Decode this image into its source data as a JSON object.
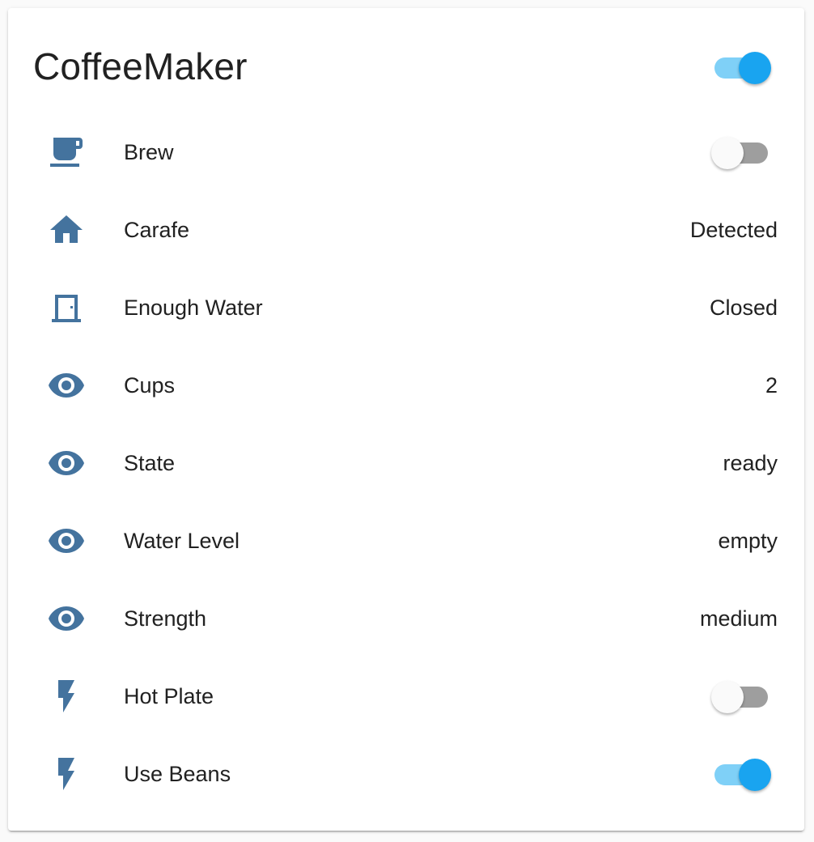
{
  "card": {
    "title": "CoffeeMaker",
    "master_toggle_on": true
  },
  "rows": [
    {
      "label": "Brew",
      "icon": "coffee-cup-icon",
      "kind": "toggle",
      "on": false
    },
    {
      "label": "Carafe",
      "icon": "home-icon",
      "kind": "value",
      "value": "Detected"
    },
    {
      "label": "Enough Water",
      "icon": "door-icon",
      "kind": "value",
      "value": "Closed"
    },
    {
      "label": "Cups",
      "icon": "eye-icon",
      "kind": "value",
      "value": "2"
    },
    {
      "label": "State",
      "icon": "eye-icon",
      "kind": "value",
      "value": "ready"
    },
    {
      "label": "Water Level",
      "icon": "eye-icon",
      "kind": "value",
      "value": "empty"
    },
    {
      "label": "Strength",
      "icon": "eye-icon",
      "kind": "value",
      "value": "medium"
    },
    {
      "label": "Hot Plate",
      "icon": "flash-icon",
      "kind": "toggle",
      "on": false
    },
    {
      "label": "Use Beans",
      "icon": "flash-icon",
      "kind": "toggle",
      "on": true
    }
  ],
  "colors": {
    "icon": "#44739e",
    "toggle_on_thumb": "#19a4f0",
    "toggle_on_track": "#7fd0f7",
    "toggle_off_thumb": "#fafafa",
    "toggle_off_track": "#9e9e9e"
  }
}
